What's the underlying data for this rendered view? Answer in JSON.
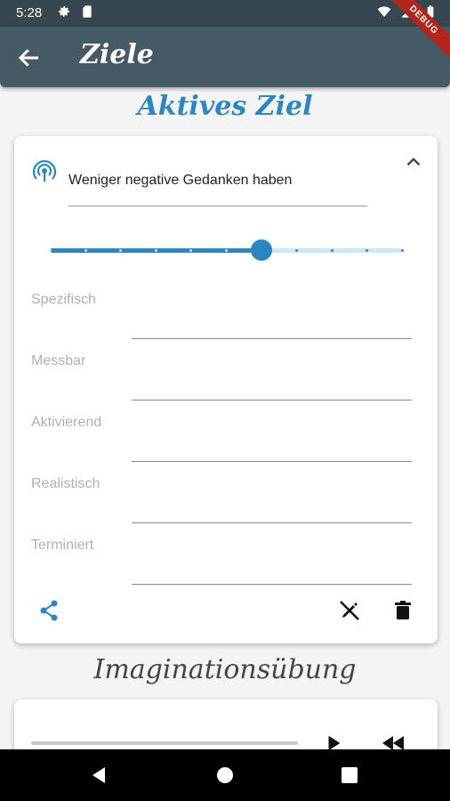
{
  "status_bar": {
    "time": "5:28"
  },
  "debug_banner": "DEBUG",
  "app_bar": {
    "title": "Ziele"
  },
  "active_goal": {
    "heading": "Aktives Ziel",
    "title": "Weniger negative Gedanken haben",
    "slider": {
      "value": 6,
      "min": 0,
      "max": 10,
      "divisions": 10
    },
    "fields": [
      {
        "label": "Spezifisch",
        "value": ""
      },
      {
        "label": "Messbar",
        "value": ""
      },
      {
        "label": "Aktivierend",
        "value": ""
      },
      {
        "label": "Realistisch",
        "value": ""
      },
      {
        "label": "Terminiert",
        "value": ""
      }
    ]
  },
  "imagination": {
    "heading": "Imaginationsübung",
    "progress": 0
  },
  "colors": {
    "app_bar": "#455a64",
    "accent": "#2e86c1",
    "status_bar": "#37474f"
  }
}
